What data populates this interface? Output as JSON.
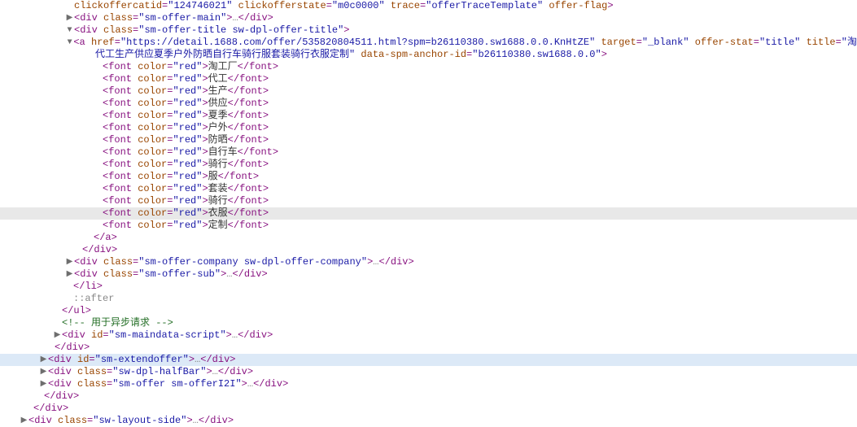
{
  "first_line": {
    "attr1": {
      "name": "clickoffercatid",
      "val": "124746021"
    },
    "attr2": {
      "name": "clickofferstate",
      "val": "m0c0000"
    },
    "attr3": {
      "name": "trace",
      "val": "offerTraceTemplate"
    },
    "flag": "offer-flag",
    "close": ">"
  },
  "div_offer_main": {
    "class": "sm-offer-main"
  },
  "div_offer_title": {
    "class": "sm-offer-title sw-dpl-offer-title"
  },
  "anchor": {
    "href": "https://detail.1688.com/offer/535820804511.html?spm=b26110380.sw1688.0.0.KnHtZE",
    "target": "_blank",
    "offer_stat": "title",
    "title_prefix": "淘",
    "title_cont": "代工生产供应夏季户外防晒自行车骑行服套装骑行衣服定制",
    "data_spm": "b26110380.sw1688.0.0"
  },
  "font_items": [
    {
      "text": "淘工厂"
    },
    {
      "text": "代工"
    },
    {
      "text": "生产"
    },
    {
      "text": "供应"
    },
    {
      "text": "夏季"
    },
    {
      "text": "户外"
    },
    {
      "text": "防晒"
    },
    {
      "text": "自行车"
    },
    {
      "text": "骑行"
    },
    {
      "text": "服"
    },
    {
      "text": "套装"
    },
    {
      "text": "骑行"
    },
    {
      "text": "衣服"
    },
    {
      "text": "定制"
    }
  ],
  "font_color": "red",
  "highlight_index": 12,
  "div_company": {
    "class": "sm-offer-company sw-dpl-offer-company"
  },
  "div_sub": {
    "class": "sm-offer-sub"
  },
  "comment": " 用于异步请求 ",
  "div_maindata": {
    "id": "sm-maindata-script"
  },
  "div_extend": {
    "id": "sm-extendoffer"
  },
  "div_halfbar": {
    "class": "sw-dpl-halfBar"
  },
  "div_i2i": {
    "class": "sm-offer sm-offerI2I"
  },
  "div_layout": {
    "class": "sw-layout-side"
  }
}
